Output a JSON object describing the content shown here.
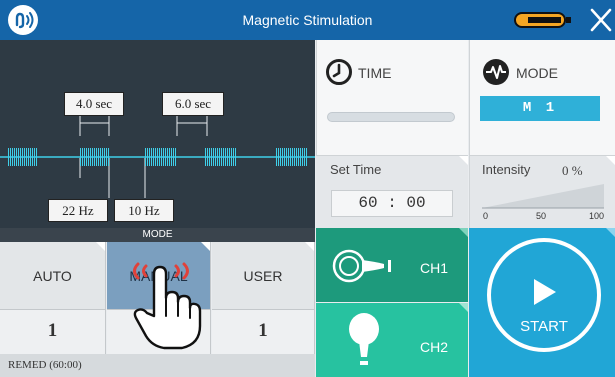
{
  "header": {
    "title": "Magnetic Stimulation",
    "colors": {
      "bar": "#1565a8",
      "battery": "#f5a623"
    }
  },
  "waveform": {
    "on_duration": "4.0 sec",
    "off_duration": "6.0 sec",
    "frequency_1": "22 Hz",
    "frequency_2": "10 Hz"
  },
  "mode_bar": {
    "label": "MODE"
  },
  "mode_buttons": [
    {
      "label": "AUTO",
      "value": "1"
    },
    {
      "label": "MANUAL",
      "value": "",
      "selected": true
    },
    {
      "label": "USER",
      "value": "1"
    }
  ],
  "status": {
    "remed": "REMED (60:00)"
  },
  "time_panel": {
    "label": "TIME",
    "progress": 0
  },
  "mode_panel": {
    "label": "MODE",
    "value": "M 1"
  },
  "set_time": {
    "label": "Set Time",
    "value": "60 : 00"
  },
  "intensity": {
    "label": "Intensity",
    "value": "0 %",
    "scale": [
      "0",
      "50",
      "100"
    ],
    "level": 0
  },
  "channels": [
    {
      "label": "CH1",
      "color": "#1d9a7c"
    },
    {
      "label": "CH2",
      "color": "#27c2a0"
    }
  ],
  "start": {
    "label": "START",
    "color": "#21a6d6"
  }
}
